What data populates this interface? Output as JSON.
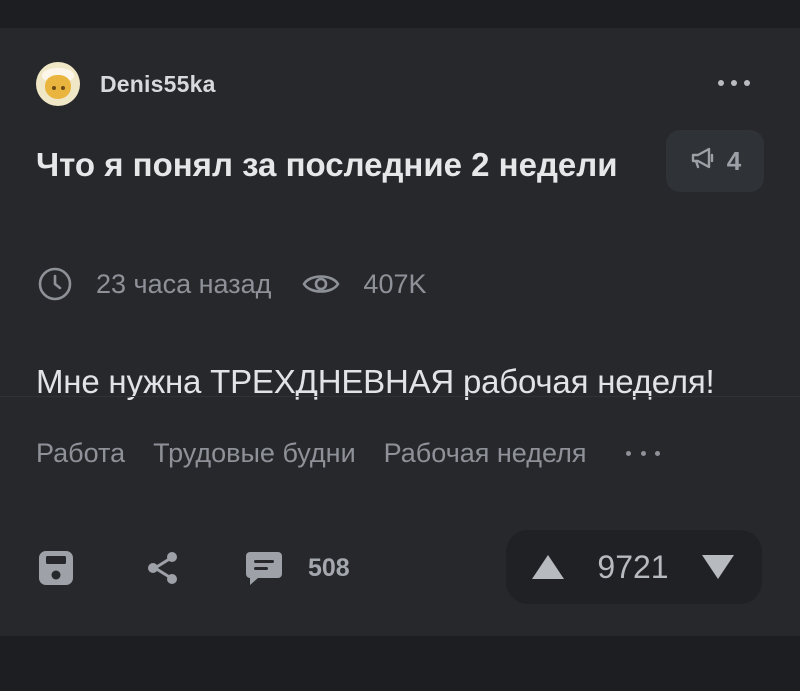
{
  "post": {
    "author": "Denis55ka",
    "title": "Что я понял за последние 2 недели",
    "awards_count": "4",
    "time": "23 часа назад",
    "views": "407K",
    "body": "Мне нужна ТРЕХДНЕВНАЯ рабочая неделя!",
    "tags": [
      "Работа",
      "Трудовые будни",
      "Рабочая неделя"
    ],
    "comments_count": "508",
    "rating": "9721"
  },
  "icons": {
    "more": "more-dots-icon",
    "award": "megaphone-icon",
    "time": "clock-icon",
    "views": "eye-icon",
    "save": "save-icon",
    "share": "share-icon",
    "comments": "comment-icon",
    "upvote": "triangle-up-icon",
    "downvote": "triangle-down-icon"
  },
  "colors": {
    "background": "#1c1e21",
    "card": "#26282c",
    "text_primary": "#e6e7e9",
    "text_secondary": "#8e9298"
  }
}
